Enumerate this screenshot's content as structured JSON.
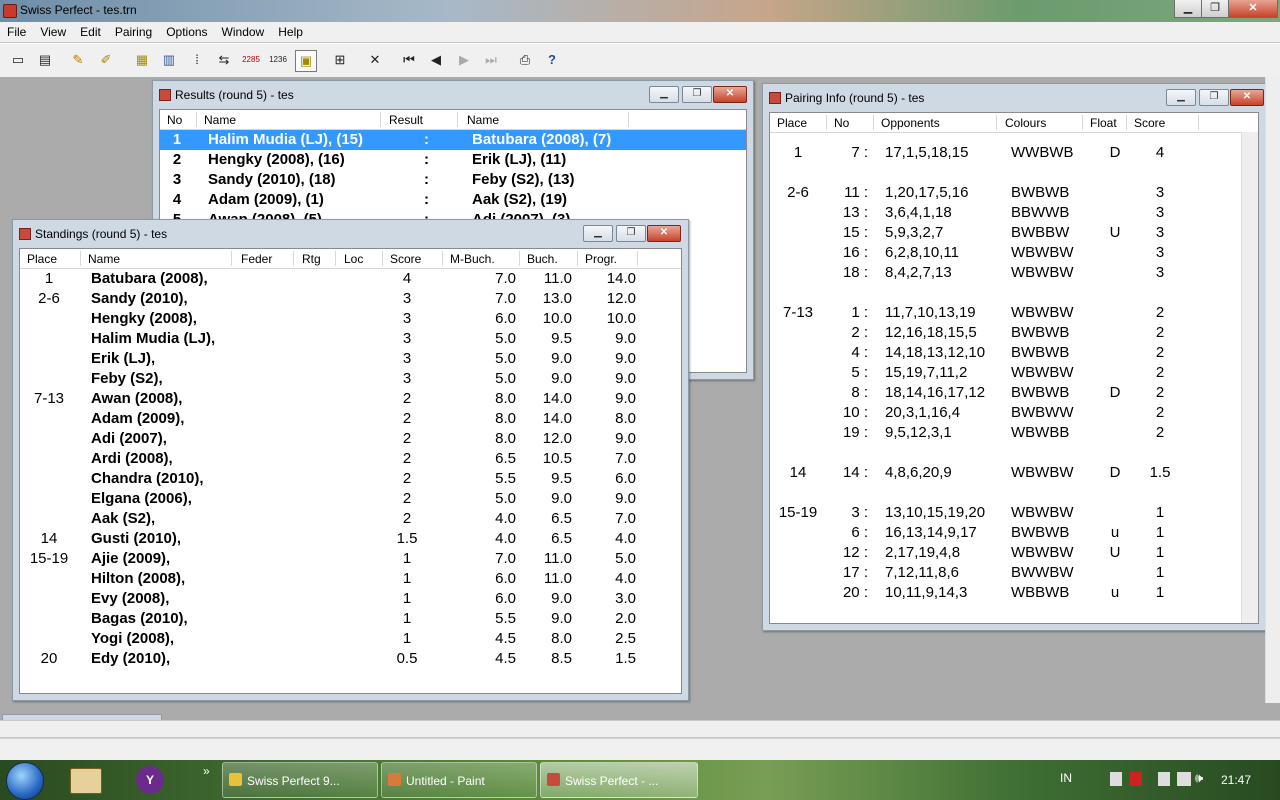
{
  "app": {
    "title": "Swiss Perfect - tes.trn",
    "controls": {
      "minimize": "▁",
      "maximize": "❐",
      "close": "✕"
    }
  },
  "menu": [
    "File",
    "View",
    "Edit",
    "Pairing",
    "Options",
    "Window",
    "Help"
  ],
  "toolbar_icons": [
    "new-tournament-icon",
    "open-tournament-icon",
    "edit-players-icon",
    "edit-players-list-icon",
    "crosstable-icon",
    "standings-icon",
    "score-icon",
    "pairing-icon",
    "rating-2285-icon",
    "rating-1236-icon",
    "export-icon",
    "table-icon",
    "cut-icon",
    "first-round-icon",
    "previous-round-icon",
    "next-round-icon",
    "last-round-icon",
    "print-icon",
    "help-icon"
  ],
  "toolbar_glyphs": {
    "rating1": "2285",
    "rating2": "1236",
    "help": "?"
  },
  "results": {
    "title": "Results  (round 5) - tes",
    "headers": [
      "No",
      "Name",
      "Result",
      "Name"
    ],
    "rows": [
      {
        "no": "1",
        "white": "Halim Mudia (LJ),  (15)",
        "result": ":",
        "black": "Batubara (2008),  (7)"
      },
      {
        "no": "2",
        "white": "Hengky (2008),  (16)",
        "result": ":",
        "black": "Erik (LJ),  (11)"
      },
      {
        "no": "3",
        "white": "Sandy (2010),  (18)",
        "result": ":",
        "black": "Feby (S2),  (13)"
      },
      {
        "no": "4",
        "white": "Adam (2009),  (1)",
        "result": ":",
        "black": "Aak (S2),  (19)"
      },
      {
        "no": "5",
        "white": "Awan (2008),  (5)",
        "result": ":",
        "black": "Adi (2007),  (3)"
      }
    ]
  },
  "standings": {
    "title": "Standings  (round 5) - tes",
    "headers": [
      "Place",
      "Name",
      "Feder",
      "Rtg",
      "Loc",
      "Score",
      "M-Buch.",
      "Buch.",
      "Progr."
    ],
    "rows": [
      {
        "place": "1",
        "name": "Batubara (2008),",
        "score": "4",
        "mbuch": "7.0",
        "buch": "11.0",
        "progr": "14.0"
      },
      {
        "place": "2-6",
        "name": "Sandy (2010),",
        "score": "3",
        "mbuch": "7.0",
        "buch": "13.0",
        "progr": "12.0"
      },
      {
        "place": "",
        "name": "Hengky (2008),",
        "score": "3",
        "mbuch": "6.0",
        "buch": "10.0",
        "progr": "10.0"
      },
      {
        "place": "",
        "name": "Halim Mudia (LJ),",
        "score": "3",
        "mbuch": "5.0",
        "buch": "9.5",
        "progr": "9.0"
      },
      {
        "place": "",
        "name": "Erik (LJ),",
        "score": "3",
        "mbuch": "5.0",
        "buch": "9.0",
        "progr": "9.0"
      },
      {
        "place": "",
        "name": "Feby (S2),",
        "score": "3",
        "mbuch": "5.0",
        "buch": "9.0",
        "progr": "9.0"
      },
      {
        "place": "7-13",
        "name": "Awan (2008),",
        "score": "2",
        "mbuch": "8.0",
        "buch": "14.0",
        "progr": "9.0"
      },
      {
        "place": "",
        "name": "Adam (2009),",
        "score": "2",
        "mbuch": "8.0",
        "buch": "14.0",
        "progr": "8.0"
      },
      {
        "place": "",
        "name": "Adi (2007),",
        "score": "2",
        "mbuch": "8.0",
        "buch": "12.0",
        "progr": "9.0"
      },
      {
        "place": "",
        "name": "Ardi (2008),",
        "score": "2",
        "mbuch": "6.5",
        "buch": "10.5",
        "progr": "7.0"
      },
      {
        "place": "",
        "name": "Chandra (2010),",
        "score": "2",
        "mbuch": "5.5",
        "buch": "9.5",
        "progr": "6.0"
      },
      {
        "place": "",
        "name": "Elgana (2006),",
        "score": "2",
        "mbuch": "5.0",
        "buch": "9.0",
        "progr": "9.0"
      },
      {
        "place": "",
        "name": "Aak (S2),",
        "score": "2",
        "mbuch": "4.0",
        "buch": "6.5",
        "progr": "7.0"
      },
      {
        "place": "14",
        "name": "Gusti (2010),",
        "score": "1.5",
        "mbuch": "4.0",
        "buch": "6.5",
        "progr": "4.0"
      },
      {
        "place": "15-19",
        "name": "Ajie (2009),",
        "score": "1",
        "mbuch": "7.0",
        "buch": "11.0",
        "progr": "5.0"
      },
      {
        "place": "",
        "name": "Hilton (2008),",
        "score": "1",
        "mbuch": "6.0",
        "buch": "11.0",
        "progr": "4.0"
      },
      {
        "place": "",
        "name": "Evy (2008),",
        "score": "1",
        "mbuch": "6.0",
        "buch": "9.0",
        "progr": "3.0"
      },
      {
        "place": "",
        "name": "Bagas (2010),",
        "score": "1",
        "mbuch": "5.5",
        "buch": "9.0",
        "progr": "2.0"
      },
      {
        "place": "",
        "name": "Yogi (2008),",
        "score": "1",
        "mbuch": "4.5",
        "buch": "8.0",
        "progr": "2.5"
      },
      {
        "place": "20",
        "name": "Edy (2010),",
        "score": "0.5",
        "mbuch": "4.5",
        "buch": "8.5",
        "progr": "1.5"
      }
    ]
  },
  "pairing_info": {
    "title": "Pairing Info  (round 5) - tes",
    "headers": [
      "Place",
      "No",
      "Opponents",
      "Colours",
      "Float",
      "Score"
    ],
    "rows": [
      {
        "place": "1",
        "no": "7 :",
        "opp": "17,1,5,18,15",
        "col": "WWBWB",
        "float": "D",
        "score": "4"
      },
      {
        "place": "2-6",
        "no": "11 :",
        "opp": "1,20,17,5,16",
        "col": "BWBWB",
        "float": "",
        "score": "3"
      },
      {
        "place": "",
        "no": "13 :",
        "opp": "3,6,4,1,18",
        "col": "BBWWB",
        "float": "",
        "score": "3"
      },
      {
        "place": "",
        "no": "15 :",
        "opp": "5,9,3,2,7",
        "col": "BWBBW",
        "float": "U",
        "score": "3"
      },
      {
        "place": "",
        "no": "16 :",
        "opp": "6,2,8,10,11",
        "col": "WBWBW",
        "float": "",
        "score": "3"
      },
      {
        "place": "",
        "no": "18 :",
        "opp": "8,4,2,7,13",
        "col": "WBWBW",
        "float": "",
        "score": "3"
      },
      {
        "place": "7-13",
        "no": "1 :",
        "opp": "11,7,10,13,19",
        "col": "WBWBW",
        "float": "",
        "score": "2"
      },
      {
        "place": "",
        "no": "2 :",
        "opp": "12,16,18,15,5",
        "col": "BWBWB",
        "float": "",
        "score": "2"
      },
      {
        "place": "",
        "no": "4 :",
        "opp": "14,18,13,12,10",
        "col": "BWBWB",
        "float": "",
        "score": "2"
      },
      {
        "place": "",
        "no": "5 :",
        "opp": "15,19,7,11,2",
        "col": "WBWBW",
        "float": "",
        "score": "2"
      },
      {
        "place": "",
        "no": "8 :",
        "opp": "18,14,16,17,12",
        "col": "BWBWB",
        "float": "D",
        "score": "2"
      },
      {
        "place": "",
        "no": "10 :",
        "opp": "20,3,1,16,4",
        "col": "BWBWW",
        "float": "",
        "score": "2"
      },
      {
        "place": "",
        "no": "19 :",
        "opp": "9,5,12,3,1",
        "col": "WBWBB",
        "float": "",
        "score": "2"
      },
      {
        "place": "14",
        "no": "14 :",
        "opp": "4,8,6,20,9",
        "col": "WBWBW",
        "float": "D",
        "score": "1.5"
      },
      {
        "place": "15-19",
        "no": "3 :",
        "opp": "13,10,15,19,20",
        "col": "WBWBW",
        "float": "",
        "score": "1"
      },
      {
        "place": "",
        "no": "6 :",
        "opp": "16,13,14,9,17",
        "col": "BWBWB",
        "float": "u",
        "score": "1"
      },
      {
        "place": "",
        "no": "12 :",
        "opp": "2,17,19,4,8",
        "col": "WBWBW",
        "float": "U",
        "score": "1"
      },
      {
        "place": "",
        "no": "17 :",
        "opp": "7,12,11,8,6",
        "col": "BWWBW",
        "float": "",
        "score": "1"
      },
      {
        "place": "",
        "no": "20 :",
        "opp": "10,11,9,14,3",
        "col": "WBBWB",
        "float": "u",
        "score": "1"
      }
    ]
  },
  "taskbar": {
    "tasks": [
      "Swiss Perfect 9...",
      "Untitled - Paint",
      "Swiss Perfect - ..."
    ],
    "language": "IN",
    "clock": "21:47",
    "expand": "»"
  },
  "colors": {
    "selection": "#3399ff",
    "window_frame": "#cfd9e4"
  }
}
